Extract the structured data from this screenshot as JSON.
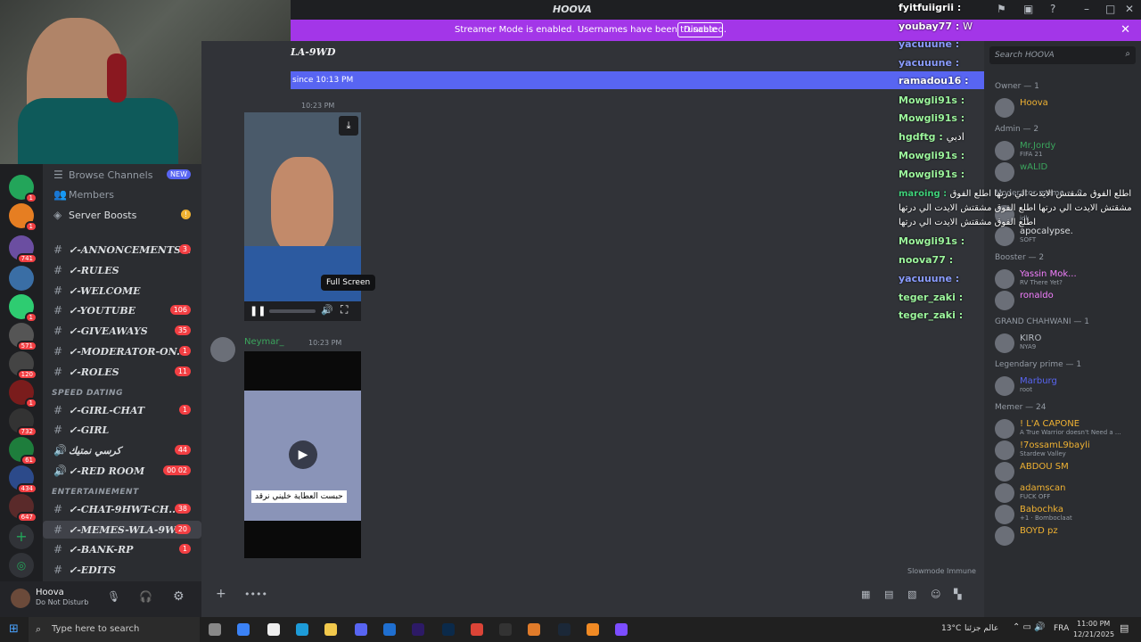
{
  "window": {
    "title": "HOOVA"
  },
  "banner": {
    "message": "Streamer Mode is enabled. Usernames have been truncated.",
    "disable_label": "Disable"
  },
  "channel": {
    "header": "LA-9WD",
    "new_since": "since 10:13 PM"
  },
  "search": {
    "placeholder": "Search HOOVA"
  },
  "server_rail": {
    "badges": [
      "1",
      "1",
      "741",
      "1",
      "571",
      "120",
      "1",
      "732",
      "61",
      "434",
      "647"
    ]
  },
  "sidebar": {
    "browse": "Browse Channels",
    "new_badge": "NEW",
    "members": "Members",
    "boosts": "Server Boosts",
    "channels": [
      {
        "name": "✓-ANNONCEMENTS...",
        "count": "3"
      },
      {
        "name": "✓-RULES",
        "count": ""
      },
      {
        "name": "✓-WELCOME",
        "count": ""
      },
      {
        "name": "✓-YOUTUBE",
        "count": "106"
      },
      {
        "name": "✓-GIVEAWAYS",
        "count": "35"
      },
      {
        "name": "✓-MODERATOR-ON...",
        "count": "1"
      },
      {
        "name": "✓-ROLES",
        "count": "11"
      }
    ],
    "cat_speed": "SPEED DATING",
    "speed": [
      {
        "name": "✓-GIRL-CHAT",
        "count": "1"
      },
      {
        "name": "✓-GIRL",
        "count": ""
      },
      {
        "name": "كرسي نمتيك",
        "count": "44"
      },
      {
        "name": "✓-RED ROOM",
        "count": "00 02"
      }
    ],
    "cat_ent": "ENTERTAINEMENT",
    "ent": [
      {
        "name": "✓-CHAT-9HWT-CH...",
        "count": "38"
      },
      {
        "name": "✓-MEMES-WLA-9W...",
        "count": "20"
      },
      {
        "name": "✓-BANK-RP",
        "count": "1"
      },
      {
        "name": "✓-EDITS",
        "count": ""
      }
    ]
  },
  "user": {
    "name": "Hoova",
    "status": "Do Not Disturb"
  },
  "messages": [
    {
      "time": "10:23 PM",
      "tooltip": "Full Screen"
    },
    {
      "author": "Neymar_",
      "time": "10:23 PM",
      "caption": "حبست العطاية خليني نرقد"
    }
  ],
  "slowmode": "Slowmode Immune",
  "twitch_chat": [
    {
      "user": "fyitfuiigrii",
      "msg": "",
      "color": "#ffffff"
    },
    {
      "user": "youbay77",
      "msg": "W",
      "color": "#ffffff"
    },
    {
      "user": "yacuuune",
      "msg": "",
      "color": "#8a9cff"
    },
    {
      "user": "yacuuune",
      "msg": "",
      "color": "#8a9cff"
    },
    {
      "user": "ramadou16",
      "msg": "",
      "color": "#ffffff"
    },
    {
      "user": "Mowgli91s",
      "msg": "",
      "color": "#9cf59c"
    },
    {
      "user": "Mowgli91s",
      "msg": "",
      "color": "#9cf59c"
    },
    {
      "user": "hgdftg",
      "msg": "ادبي",
      "color": "#9cf59c"
    },
    {
      "user": "Mowgli91s",
      "msg": "",
      "color": "#9cf59c"
    },
    {
      "user": "Mowgli91s",
      "msg": "",
      "color": "#9cf59c"
    },
    {
      "user": "maroing",
      "msg": "اطلع الفوق مشقتش الايدت الي درتها اطلع الفوق مشقتش الايدت الي درتها اطلع الفوق مشقتش الايدت الي درتها اطلع الفوق مشقتش الايدت الي درتها",
      "color": "#3fd17a"
    },
    {
      "user": "Mowgli91s",
      "msg": "",
      "color": "#9cf59c"
    },
    {
      "user": "noova77",
      "msg": "",
      "color": "#9cf59c"
    },
    {
      "user": "yacuuune",
      "msg": "",
      "color": "#8a9cff"
    },
    {
      "user": "teger_zaki",
      "msg": "",
      "color": "#9cf59c"
    },
    {
      "user": "teger_zaki",
      "msg": "",
      "color": "#9cf59c"
    }
  ],
  "members": {
    "owner_h": "Owner — 1",
    "owner": [
      {
        "name": "Hoova",
        "sub": "",
        "color": "#f0b232"
      }
    ],
    "admin_h": "Admin — 2",
    "admin": [
      {
        "name": "Mr.Jordy",
        "sub": "FIFA 21",
        "color": "#3ba55d"
      },
      {
        "name": "wALID",
        "sub": "",
        "color": "#3ba55d"
      }
    ],
    "mod_h": "Moderator meme — 2",
    "mod": [
      {
        "name": "",
        "sub": "idk",
        "color": "#c6c6ff"
      },
      {
        "name": "apocalypse.",
        "sub": "SOFT",
        "color": "#dbdee1"
      }
    ],
    "boost_h": "Booster — 2",
    "boost": [
      {
        "name": "Yassin Mok...",
        "sub": "RV There Yet?",
        "color": "#f47fff"
      },
      {
        "name": "ronaldo",
        "sub": "",
        "color": "#f47fff"
      }
    ],
    "gc_h": "GRAND CHAHWANI — 1",
    "gc": [
      {
        "name": "KIRO",
        "sub": "NYA9",
        "color": "#b5bac1"
      }
    ],
    "lp_h": "Legendary prime — 1",
    "lp": [
      {
        "name": "Marburg",
        "sub": "root",
        "color": "#5865f2"
      }
    ],
    "memer_h": "Memer — 24",
    "memer": [
      {
        "name": "! L'A CAPONE",
        "sub": "A True Warrior doesn't Need a ...",
        "color": "#f0b232"
      },
      {
        "name": "!7ossamL9bayli",
        "sub": "Stardew Valley",
        "color": "#f0b232"
      },
      {
        "name": "ABDOU SM",
        "sub": "",
        "color": "#f0b232"
      },
      {
        "name": "adamscan",
        "sub": "FUCK OFF",
        "color": "#f0b232"
      },
      {
        "name": "Babochka",
        "sub": "+1 · Bomboclaat",
        "color": "#f0b232"
      },
      {
        "name": "BOYD pz",
        "sub": "",
        "color": "#f0b232"
      }
    ]
  },
  "taskbar": {
    "search": "Type here to search",
    "weather": "13°C",
    "news": "عالم جزئنا",
    "lang": "FRA",
    "time": "11:00 PM",
    "date": "12/21/2025"
  }
}
